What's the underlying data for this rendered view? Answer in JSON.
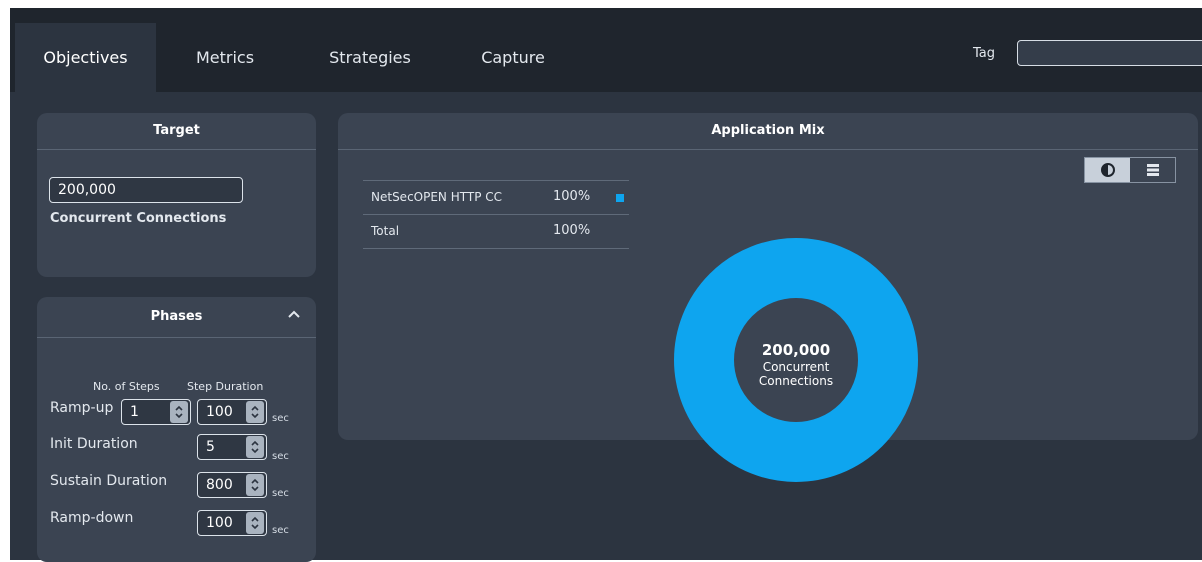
{
  "tabs": [
    {
      "label": "Objectives",
      "active": true
    },
    {
      "label": "Metrics",
      "active": false
    },
    {
      "label": "Strategies",
      "active": false
    },
    {
      "label": "Capture",
      "active": false
    }
  ],
  "tag": {
    "label": "Tag",
    "value": ""
  },
  "target": {
    "title": "Target",
    "value": "200,000",
    "unit_label": "Concurrent Connections"
  },
  "phases": {
    "title": "Phases",
    "col_steps": "No. of Steps",
    "col_duration": "Step Duration",
    "unit": "sec",
    "rows": [
      {
        "label": "Ramp-up",
        "steps": "1",
        "duration": "100"
      },
      {
        "label": "Init Duration",
        "duration": "5"
      },
      {
        "label": "Sustain Duration",
        "duration": "800"
      },
      {
        "label": "Ramp-down",
        "duration": "100"
      }
    ]
  },
  "mix": {
    "title": "Application Mix",
    "rows": [
      {
        "name": "NetSecOPEN HTTP CC",
        "pct": "100%",
        "color": "#0ea5ef"
      },
      {
        "name": "Total",
        "pct": "100%"
      }
    ],
    "view_modes": [
      "contrast-icon",
      "list-icon"
    ],
    "donut": {
      "value": "200,000",
      "line1": "Concurrent",
      "line2": "Connections",
      "color": "#0ea5ef",
      "fraction": 1.0
    }
  },
  "colors": {
    "accent": "#0ea5ef",
    "panel": "#3b4452",
    "background": "#2c3440"
  }
}
